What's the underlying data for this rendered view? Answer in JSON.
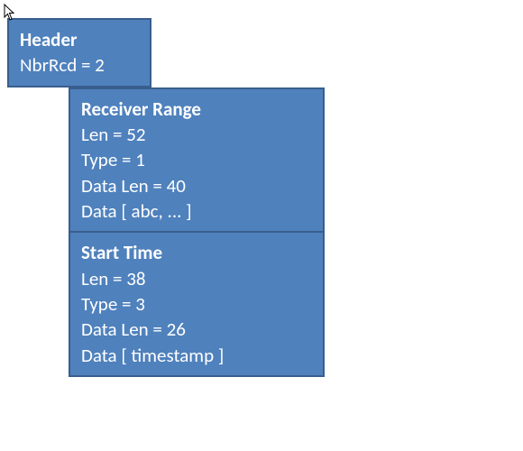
{
  "header": {
    "title": "Header",
    "nbrRcdLine": "NbrRcd = 2"
  },
  "records": [
    {
      "title": "Receiver Range",
      "lenLine": "Len = 52",
      "typeLine": "Type = 1",
      "dataLenLine": "Data Len = 40",
      "dataLine": "Data [ abc, ... ]"
    },
    {
      "title": "Start Time",
      "lenLine": "Len = 38",
      "typeLine": "Type = 3",
      "dataLenLine": "Data Len = 26",
      "dataLine": "Data [ timestamp ]"
    }
  ]
}
